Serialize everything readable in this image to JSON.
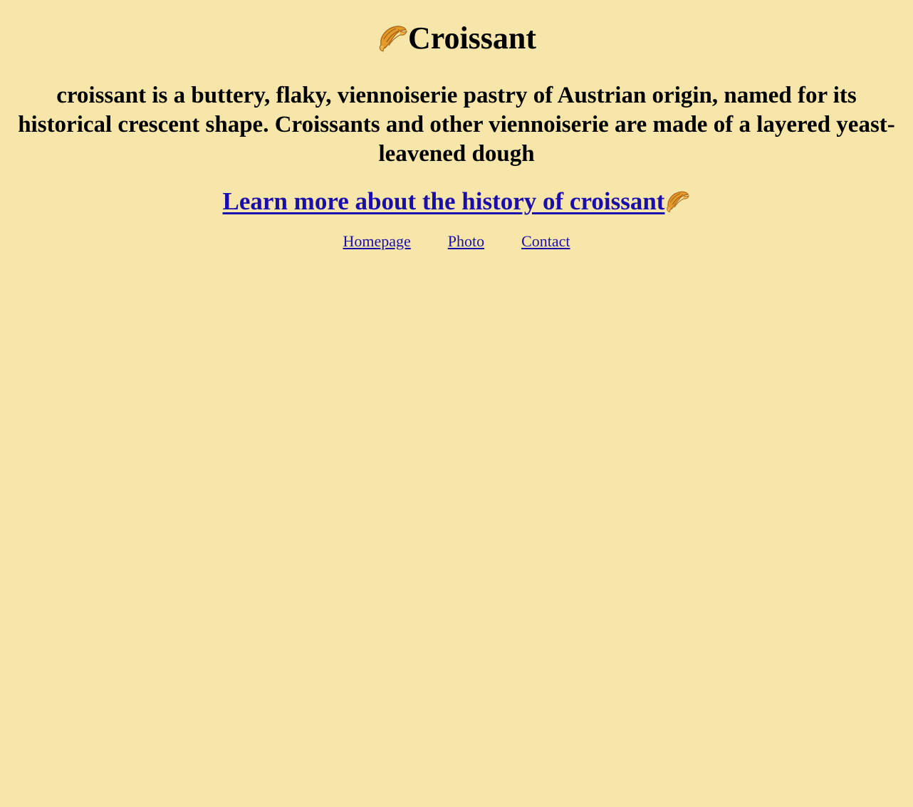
{
  "page": {
    "background": "#f6e6a9",
    "title": "Croissant",
    "title_icon": "croissant-icon",
    "intro": "croissant is a buttery, flaky, viennoiserie pastry of Austrian origin, named for its historical crescent shape. Croissants and other viennoiserie are made of a layered yeast-leavened dough",
    "history_link": {
      "label": "Learn more about the history of croissant",
      "icon": "croissant-icon",
      "color": "#1a0dab"
    },
    "nav": {
      "items": [
        {
          "label": "Homepage"
        },
        {
          "label": "Photo"
        },
        {
          "label": "Contact"
        }
      ]
    }
  }
}
